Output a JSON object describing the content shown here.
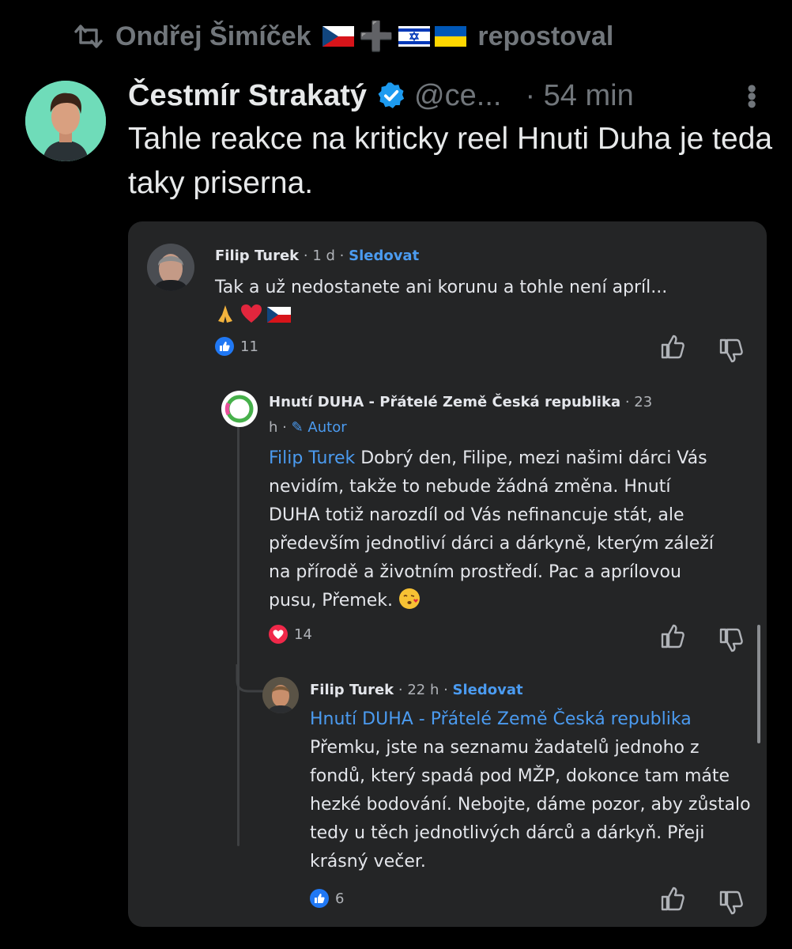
{
  "repost": {
    "user": "Ondřej Šimíček",
    "label": "repostoval"
  },
  "tweet": {
    "author_name": "Čestmír Strakatý",
    "handle": "@ce...",
    "time": "· 54 min",
    "text": "Tahle reakce na kriticky reel Hnuti Duha je teda taky priserna."
  },
  "screenshot": {
    "comment1": {
      "author": "Filip Turek",
      "age": "· 1 d ·",
      "follow": "Sledovat",
      "text": "Tak a už nedostanete ani korunu a tohle není apríl...",
      "reaction_count": "11"
    },
    "comment2": {
      "author": "Hnutí DUHA - Přátelé Země Česká republika",
      "age_part1": "· 23",
      "age_part2": "h ·",
      "author_badge": "Autor",
      "mention": "Filip Turek",
      "text": " Dobrý den, Filipe, mezi našimi dárci Vás nevidím, takže to nebude žádná změna. Hnutí DUHA totiž narozdíl od Vás nefinancuje stát, ale především jednotliví dárci a dárkyně, kterým záleží na přírodě a životním prostředí. Pac a aprílovou pusu, Přemek.",
      "reaction_count": "14"
    },
    "comment3": {
      "author": "Filip Turek",
      "age": "· 22 h ·",
      "follow": "Sledovat",
      "mention": "Hnutí DUHA - Přátelé Země Česká republika",
      "text": "Přemku, jste na seznamu žadatelů jednoho z fondů, který spadá pod MŽP, dokonce tam máte hezké bodování. Nebojte, dáme pozor, aby zůstalo tedy u těch jednotlivých dárců a dárkyň. Přeji krásný večer.",
      "reaction_count": "6"
    }
  },
  "colors": {
    "background": "#000000",
    "muted": "#71767b",
    "verified": "#1d9bf0",
    "link": "#4b9bf0",
    "card": "#242526"
  },
  "icons": [
    "repost-icon",
    "verified-icon",
    "more-icon",
    "like-icon",
    "dislike-icon",
    "heart-icon"
  ]
}
